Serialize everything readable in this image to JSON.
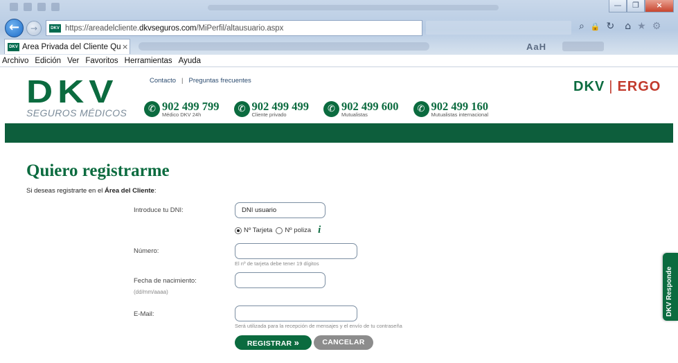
{
  "browser": {
    "url_prefix": "https://areadelcliente.",
    "url_domain": "dkvseguros.com",
    "url_path": "/MiPerfil/altausuario.aspx",
    "tab_title": "Área Privada del Cliente Qu...",
    "tab_close": "×",
    "favicon_text": "DKV",
    "back_glyph": "←",
    "forward_glyph": "→",
    "menu": [
      "Archivo",
      "Edición",
      "Ver",
      "Favoritos",
      "Herramientas",
      "Ayuda"
    ],
    "window_buttons": {
      "minimize": "—",
      "maximize": "❐",
      "close": "×"
    },
    "toolbar_glyphs": {
      "search": "⌕",
      "lock": "🔒",
      "refresh": "↻",
      "home": "⌂",
      "favorites": "★",
      "settings": "⚙"
    },
    "faded_tab_text": "AaH"
  },
  "header": {
    "logo_main": "DKV",
    "logo_sub": "SEGUROS MÉDICOS",
    "links": {
      "contact": "Contacto",
      "separator": "|",
      "faq": "Preguntas frecuentes"
    },
    "phones": [
      {
        "number": "902 499 799",
        "label": "Médico DKV 24h"
      },
      {
        "number": "902 499 499",
        "label": "Cliente privado"
      },
      {
        "number": "902 499 600",
        "label": "Mutualistas"
      },
      {
        "number": "902 499 160",
        "label": "Mutualistas internacional"
      }
    ],
    "phone_glyph": "✆",
    "brand_dkv": "DKV",
    "brand_sep": "|",
    "brand_ergo": "ERGO"
  },
  "form": {
    "title": "Quiero registrarme",
    "intro_prefix": "Si deseas registrarte en el ",
    "intro_bold": "Área del Cliente",
    "intro_suffix": ":",
    "dni_label": "Introduce tu DNI:",
    "dni_value": "DNI usuario",
    "radio_card": "Nº Tarjeta",
    "radio_policy": "Nº poliza",
    "radio_selected": "card",
    "info_glyph": "i",
    "number_label": "Número:",
    "number_value": "",
    "number_hint": "El nº de tarjeta debe tener 19 dígitos",
    "birth_label": "Fecha de nacimiento:",
    "birth_format": "(dd/mm/aaaa)",
    "birth_value": "",
    "email_label": "E-Mail:",
    "email_value": "",
    "email_hint": "Será utilizada para la recepción de mensajes y el envío de tu contraseña",
    "submit_label": "REGISTRAR",
    "submit_glyph": "»",
    "cancel_label": "CANCELAR"
  },
  "side_tab": {
    "label": "DKV Responde"
  },
  "colors": {
    "brand_green": "#0b6b3f",
    "bar_green": "#0d5e3c",
    "ergo_red": "#c23a2c",
    "cancel_gray": "#8c8c8c"
  }
}
